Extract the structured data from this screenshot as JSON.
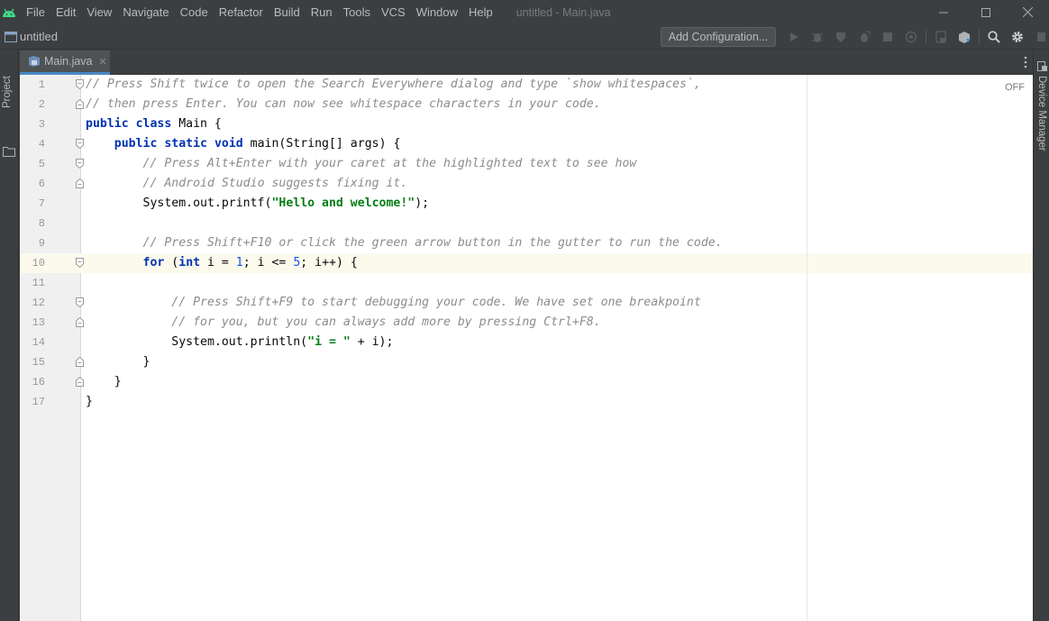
{
  "app": {
    "menu": [
      "File",
      "Edit",
      "View",
      "Navigate",
      "Code",
      "Refactor",
      "Build",
      "Run",
      "Tools",
      "VCS",
      "Window",
      "Help"
    ],
    "window_title": "untitled - Main.java"
  },
  "navbar": {
    "project_name": "untitled",
    "add_configuration_label": "Add Configuration..."
  },
  "left_strip": {
    "project_label": "Project"
  },
  "right_strip": {
    "device_manager_label": "Device Manager"
  },
  "tabs": [
    {
      "label": "Main.java",
      "active": true
    }
  ],
  "editor": {
    "inspection_status": "OFF",
    "caret_line": 10,
    "lines": [
      {
        "n": "1",
        "text": "// Press Shift twice to open the Search Everywhere dialog and type `show whitespaces`,"
      },
      {
        "n": "2",
        "text": "// then press Enter. You can now see whitespace characters in your code."
      },
      {
        "n": "3",
        "text": "public class Main {"
      },
      {
        "n": "4",
        "text": "    public static void main(String[] args) {"
      },
      {
        "n": "5",
        "text": "        // Press Alt+Enter with your caret at the highlighted text to see how"
      },
      {
        "n": "6",
        "text": "        // Android Studio suggests fixing it."
      },
      {
        "n": "7",
        "text": "        System.out.printf(\"Hello and welcome!\");"
      },
      {
        "n": "8",
        "text": ""
      },
      {
        "n": "9",
        "text": "        // Press Shift+F10 or click the green arrow button in the gutter to run the code."
      },
      {
        "n": "10",
        "text": "        for (int i = 1; i <= 5; i++) {"
      },
      {
        "n": "11",
        "text": ""
      },
      {
        "n": "12",
        "text": "            // Press Shift+F9 to start debugging your code. We have set one breakpoint"
      },
      {
        "n": "13",
        "text": "            // for you, but you can always add more by pressing Ctrl+F8."
      },
      {
        "n": "14",
        "text": "            System.out.println(\"i = \" + i);"
      },
      {
        "n": "15",
        "text": "        }"
      },
      {
        "n": "16",
        "text": "    }"
      },
      {
        "n": "17",
        "text": "}"
      }
    ]
  },
  "colors": {
    "comment": "#8c8c8c",
    "keyword": "#0033b3",
    "string": "#067d17",
    "number": "#1750eb",
    "caret_row": "#fcfaed",
    "android_green": "#3ddc84"
  }
}
